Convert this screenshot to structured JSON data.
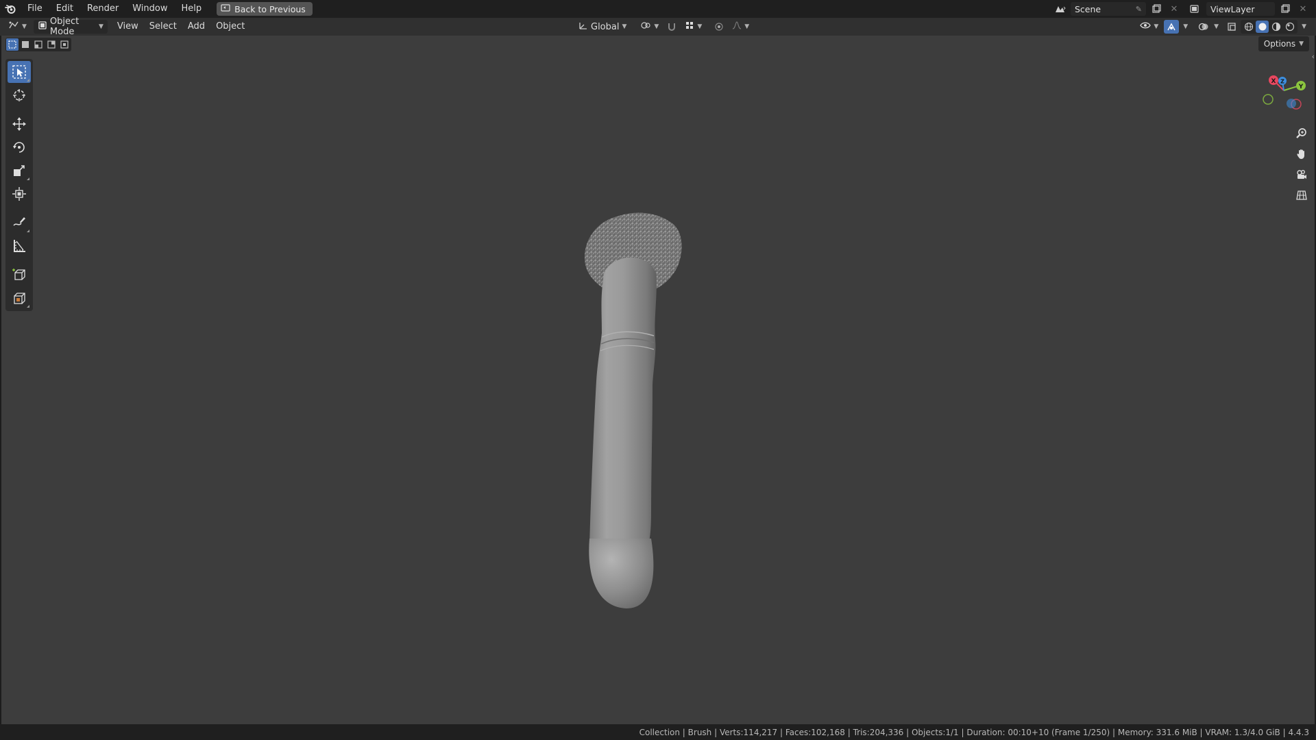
{
  "menubar": {
    "items": [
      "File",
      "Edit",
      "Render",
      "Window",
      "Help"
    ],
    "back_label": "Back to Previous",
    "scene": "Scene",
    "view_layer": "ViewLayer"
  },
  "viewport_header": {
    "mode": "Object Mode",
    "menus": [
      "View",
      "Select",
      "Add",
      "Object"
    ],
    "transform_orientation": "Global"
  },
  "viewport": {
    "options_label": "Options",
    "gizmo": {
      "x": "X",
      "y": "Y",
      "z": "Z"
    },
    "object_name": "Brush"
  },
  "toolbar": {
    "tools": [
      "select-box",
      "cursor",
      "move",
      "rotate",
      "scale",
      "transform",
      "annotate",
      "measure",
      "add-cube",
      "add-primitive"
    ],
    "active": "select-box"
  },
  "statusbar": {
    "text": "Collection | Brush | Verts:114,217 | Faces:102,168 | Tris:204,336 | Objects:1/1 | Duration: 00:10+10 (Frame 1/250) | Memory: 331.6 MiB | VRAM: 1.3/4.0 GiB | 4.4.3"
  },
  "colors": {
    "accent": "#4772b3",
    "viewport_bg": "#3d3d3d",
    "axis_x": "#e8475f",
    "axis_y": "#8cc63f",
    "axis_z": "#3d8fe0"
  }
}
